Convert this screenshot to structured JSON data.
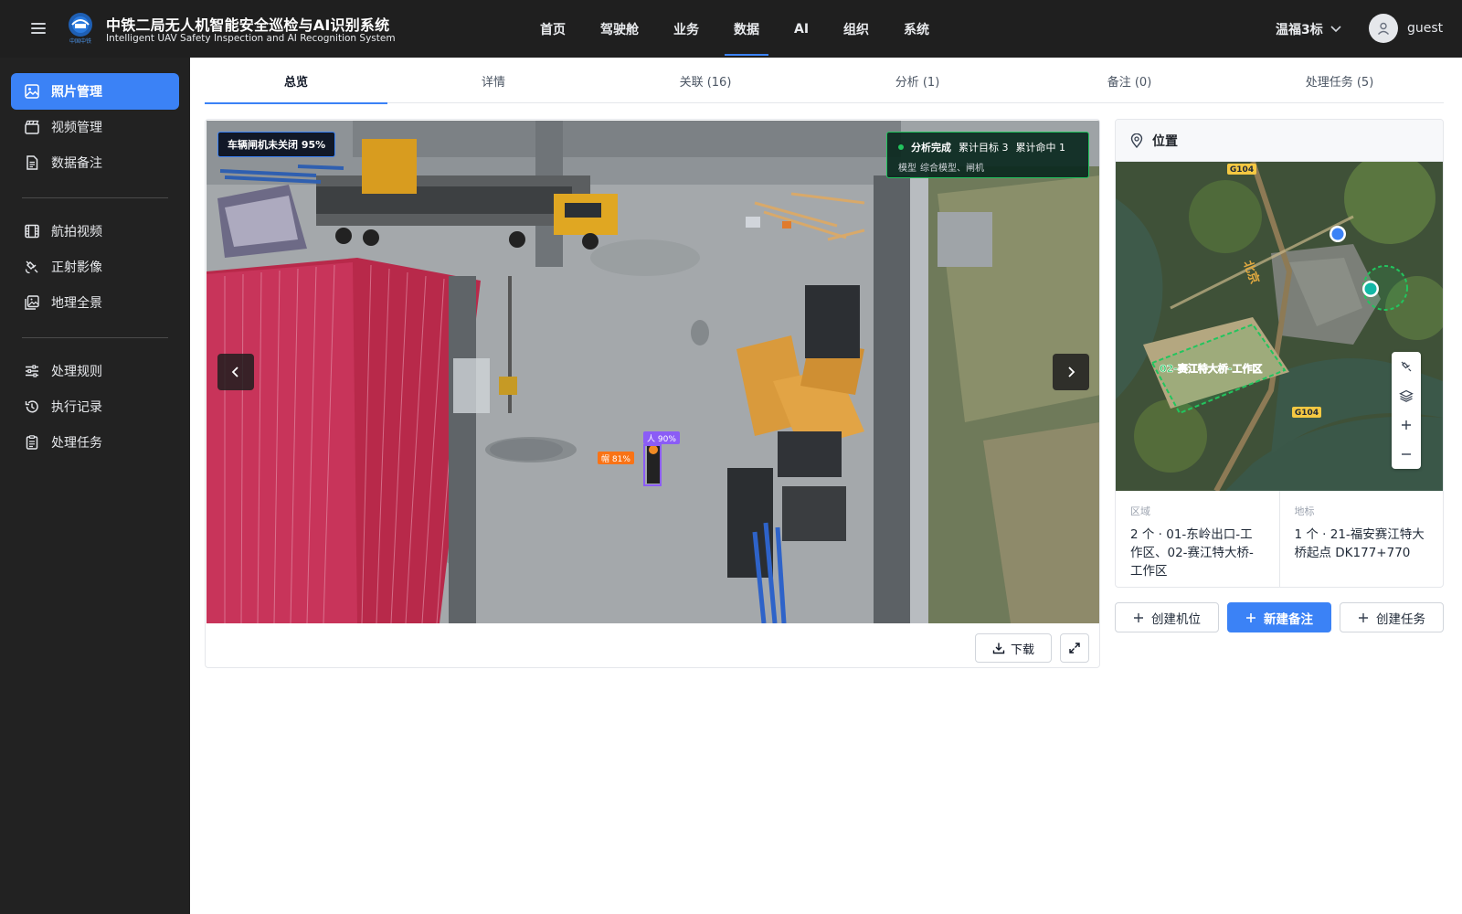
{
  "app": {
    "title": "中铁二局无人机智能安全巡检与AI识别系统",
    "subtitle": "Intelligent UAV Safety Inspection and AI Recognition System",
    "logo_text": "中国中铁"
  },
  "topnav": {
    "items": [
      "首页",
      "驾驶舱",
      "业务",
      "数据",
      "AI",
      "组织",
      "系统"
    ],
    "active": "数据"
  },
  "project": {
    "name": "温福3标"
  },
  "user": {
    "name": "guest"
  },
  "sidebar": {
    "items": [
      {
        "label": "照片管理",
        "icon": "image-icon",
        "active": true
      },
      {
        "label": "视频管理",
        "icon": "video-icon"
      },
      {
        "label": "数据备注",
        "icon": "document-icon"
      },
      {
        "label": "航拍视频",
        "icon": "film-icon"
      },
      {
        "label": "正射影像",
        "icon": "satellite-icon"
      },
      {
        "label": "地理全景",
        "icon": "panorama-icon"
      },
      {
        "label": "处理规则",
        "icon": "sliders-icon"
      },
      {
        "label": "执行记录",
        "icon": "history-icon"
      },
      {
        "label": "处理任务",
        "icon": "clipboard-icon"
      }
    ]
  },
  "tabs": {
    "items": [
      "总览",
      "详情",
      "关联 (16)",
      "分析 (1)",
      "备注 (0)",
      "处理任务 (5)"
    ],
    "active": "总览"
  },
  "photo": {
    "alert_tag": "车辆闸机未关闭 95%",
    "analysis": {
      "status": "分析完成",
      "targets": "累计目标 3",
      "hits": "累计命中 1",
      "model_label": "模型",
      "models": "综合模型、闸机"
    },
    "detections": [
      {
        "label": "人 90%",
        "color": "#8b5cf6"
      },
      {
        "label": "帽 81%",
        "color": "#f97316"
      }
    ],
    "download_label": "下载"
  },
  "location": {
    "title": "位置",
    "map_labels": {
      "road_top": "G104",
      "road_bottom": "G104",
      "work_area": "02-赛江特大桥-工作区",
      "road_name": "北京"
    },
    "area_label": "区域",
    "area_value": "2 个 · 01-东岭出口-工作区、02-赛江特大桥-工作区",
    "landmark_label": "地标",
    "landmark_value": "1 个 · 21-福安赛江特大桥起点 DK177+770"
  },
  "actions": {
    "create_position": "创建机位",
    "new_note": "新建备注",
    "create_task": "创建任务"
  },
  "colors": {
    "accent": "#3b82f6",
    "sidebar_bg": "#222222",
    "topbar_bg": "#1f1f1f",
    "success": "#22c55e"
  }
}
